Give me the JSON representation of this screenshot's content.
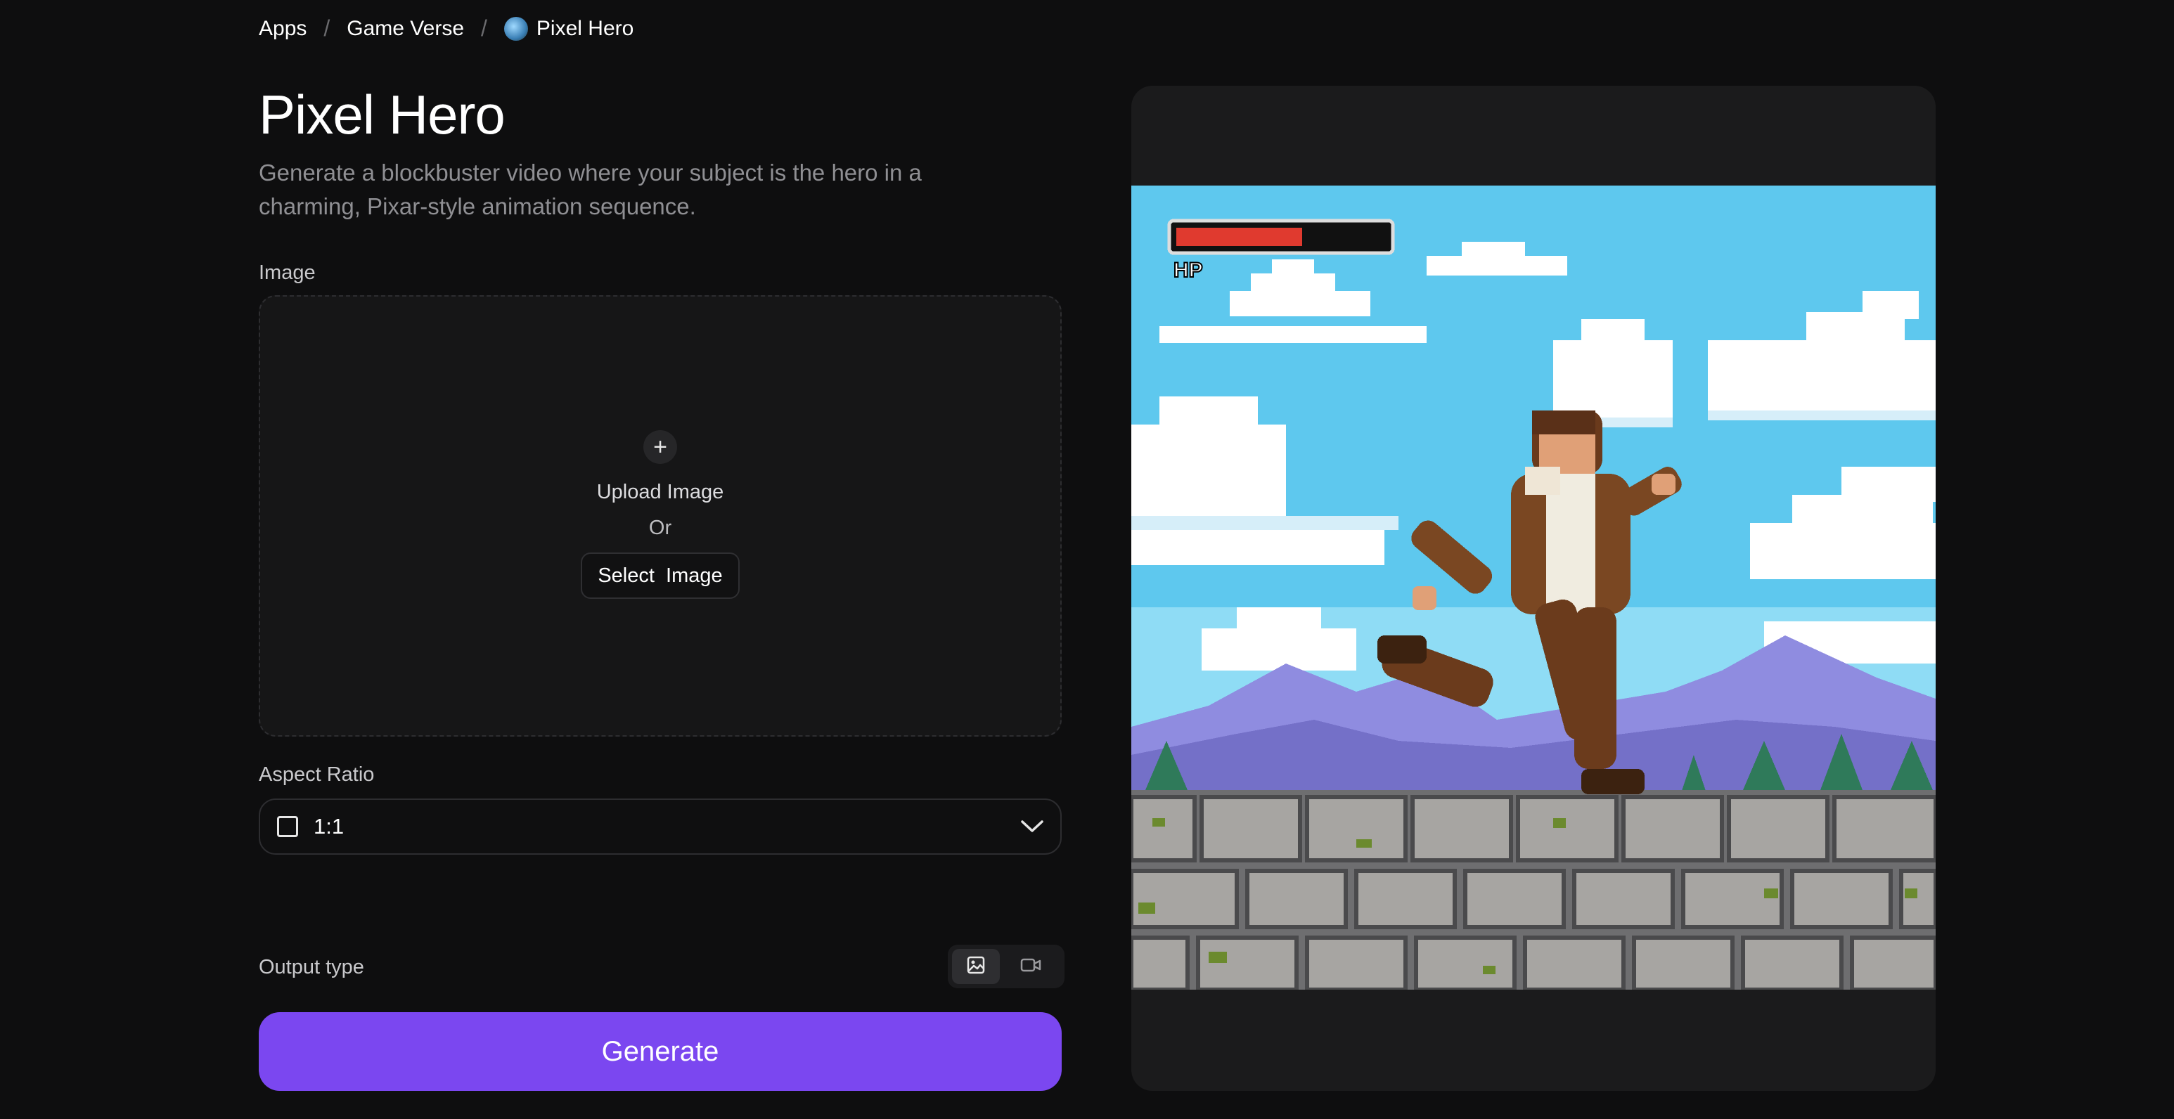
{
  "breadcrumb": {
    "items": [
      "Apps",
      "Game Verse"
    ],
    "separator": "/",
    "current": "Pixel Hero"
  },
  "page": {
    "title": "Pixel Hero",
    "description": "Generate a blockbuster video where your subject is the hero in a charming, Pixar-style animation sequence."
  },
  "image_section": {
    "label": "Image",
    "upload_text": "Upload Image",
    "or_text": "Or",
    "select_button": "Select  Image"
  },
  "aspect_ratio": {
    "label": "Aspect Ratio",
    "value": "1:1"
  },
  "output": {
    "label": "Output type",
    "options": [
      "image-icon",
      "video-icon"
    ],
    "selected": "image-icon"
  },
  "generate_label": "Generate",
  "preview": {
    "hud_label": "HP",
    "hp_fraction": 0.6
  },
  "colors": {
    "background": "#0e0e0f",
    "accent": "#7b47f0",
    "panel": "#1b1b1c",
    "sky": "#5ec8ee",
    "hp_bar": "#e03a2f"
  }
}
